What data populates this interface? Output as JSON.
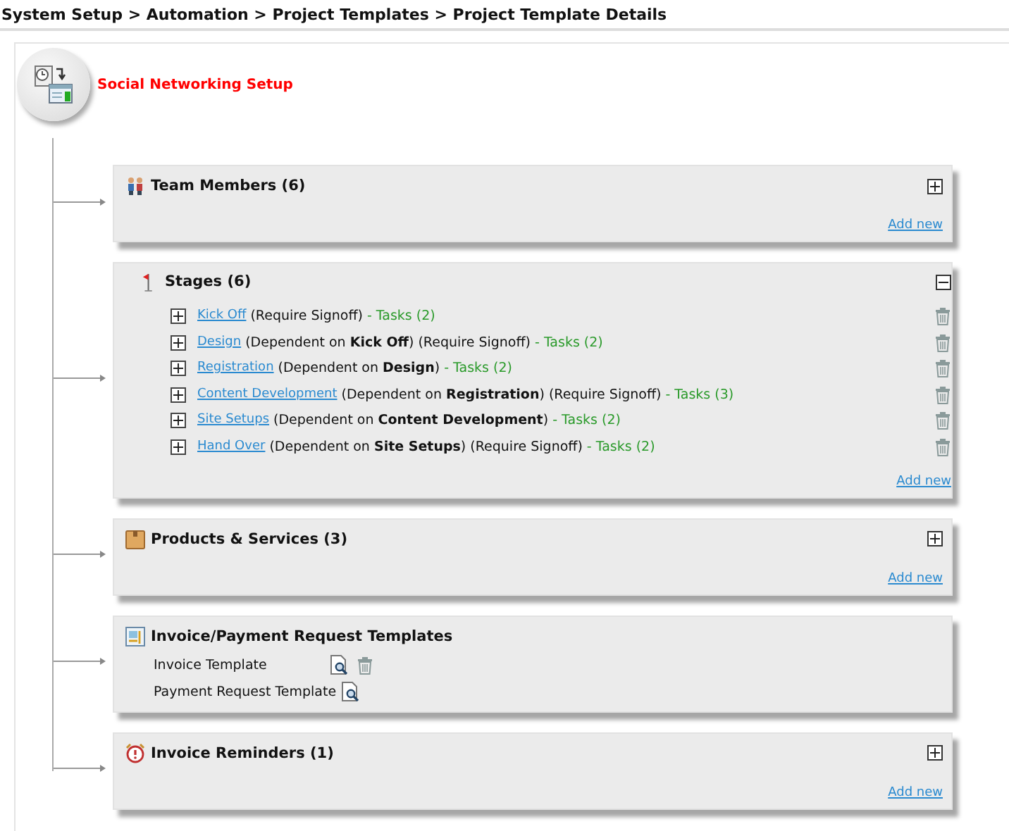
{
  "breadcrumb": "System Setup > Automation > Project Templates > Project Template Details",
  "template": {
    "title": "Social Networking Setup"
  },
  "sections": [
    {
      "kind": "team",
      "title": "Team Members (6)",
      "expanded": false,
      "add_new": "Add new"
    },
    {
      "kind": "stages",
      "title": "Stages (6)",
      "expanded": true,
      "add_new": "Add new",
      "stages": [
        {
          "name": "Kick Off",
          "detail": "(Require Signoff)",
          "tasks": "- Tasks (2)"
        },
        {
          "name": "Design",
          "detail": "(Dependent on **Kick Off**) (Require Signoff)",
          "tasks": "- Tasks (2)"
        },
        {
          "name": "Registration",
          "detail": "(Dependent on **Design**)",
          "tasks": "- Tasks (2)"
        },
        {
          "name": "Content Development",
          "detail": "(Dependent on **Registration**) (Require Signoff)",
          "tasks": "- Tasks (3)"
        },
        {
          "name": "Site Setups",
          "detail": "(Dependent on **Content Development**)",
          "tasks": "- Tasks (2)"
        },
        {
          "name": "Hand Over",
          "detail": "(Dependent on **Site Setups**) (Require Signoff)",
          "tasks": "- Tasks (2)"
        }
      ]
    },
    {
      "kind": "products",
      "title": "Products & Services (3)",
      "expanded": false,
      "add_new": "Add new"
    },
    {
      "kind": "invoices",
      "title": "Invoice/Payment Request Templates",
      "templates": [
        {
          "name": "Invoice Template",
          "deletable": true
        },
        {
          "name": "Payment Request Template",
          "deletable": false
        }
      ]
    },
    {
      "kind": "reminders",
      "title": "Invoice Reminders (1)",
      "expanded": false,
      "add_new": "Add new"
    }
  ]
}
